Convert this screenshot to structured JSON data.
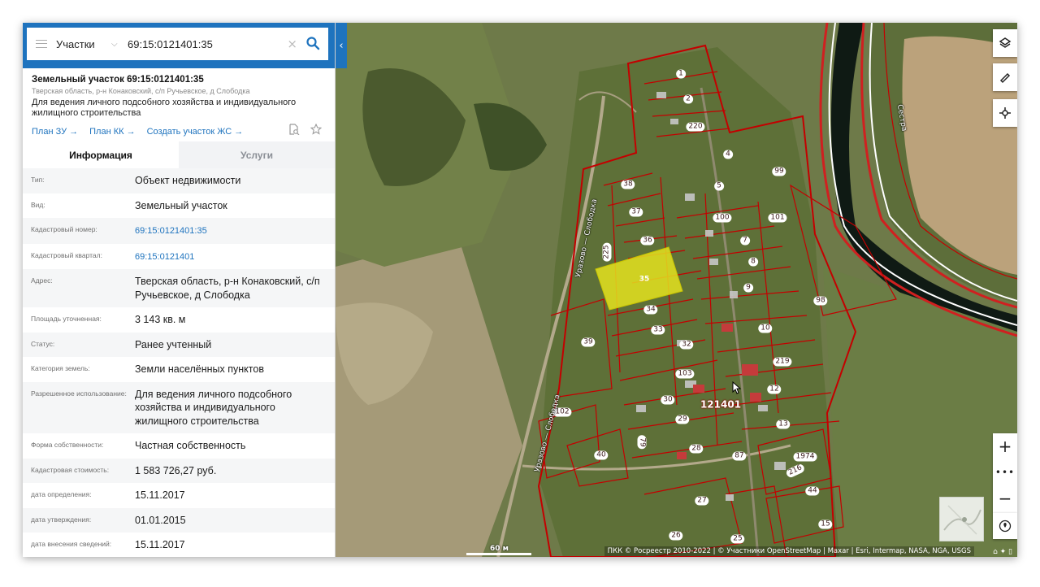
{
  "search": {
    "type_label": "Участки",
    "query": "69:15:0121401:35"
  },
  "object": {
    "title": "Земельный участок 69:15:0121401:35",
    "address": "Тверская область, р-н Конаковский, с/п Ручьевское, д Слободка",
    "purpose": "Для ведения личного подсобного хозяйства и индивидуального жилищного строительства",
    "links": [
      "План ЗУ →",
      "План КК →",
      "Создать участок ЖС →"
    ]
  },
  "tabs": [
    {
      "label": "Информация",
      "active": true
    },
    {
      "label": "Услуги",
      "active": false
    }
  ],
  "info": [
    {
      "key": "Тип:",
      "value": "Объект недвижимости"
    },
    {
      "key": "Вид:",
      "value": "Земельный участок"
    },
    {
      "key": "Кадастровый номер:",
      "value": "69:15:0121401:35",
      "link": true
    },
    {
      "key": "Кадастровый квартал:",
      "value": "69:15:0121401",
      "link": true
    },
    {
      "key": "Адрес:",
      "value": "Тверская область, р-н Конаковский, с/п Ручьевское, д Слободка"
    },
    {
      "key": "Площадь уточненная:",
      "value": "3 143 кв. м"
    },
    {
      "key": "Статус:",
      "value": "Ранее учтенный"
    },
    {
      "key": "Категория земель:",
      "value": "Земли населённых пунктов"
    },
    {
      "key": "Разрешенное использование:",
      "value": "Для ведения личного подсобного хозяйства и индивидуального жилищного строительства"
    },
    {
      "key": "Форма собственности:",
      "value": "Частная собственность"
    },
    {
      "key": "Кадастровая стоимость:",
      "value": "1 583 726,27 руб."
    },
    {
      "key": "дата определения:",
      "value": "15.11.2017"
    },
    {
      "key": "дата утверждения:",
      "value": "01.01.2015"
    },
    {
      "key": "дата внесения сведений:",
      "value": "15.11.2017"
    }
  ],
  "map": {
    "quarter_label": "121401",
    "selected_label": "35",
    "plot_labels": [
      "1",
      "2",
      "220",
      "4",
      "99",
      "38",
      "5",
      "37",
      "100",
      "101",
      "36",
      "7",
      "225",
      "8",
      "9",
      "34",
      "98",
      "33",
      "10",
      "39",
      "32",
      "219",
      "103",
      "12",
      "30",
      "102",
      "29",
      "13",
      "40",
      "79",
      "28",
      "87",
      "1974",
      "216",
      "44",
      "27",
      "15",
      "26",
      "25"
    ],
    "road_labels": [
      "Уразово — Слободка",
      "Уразово — Слободка",
      "Сестра"
    ],
    "scale_label": "60 м",
    "attribution": "ПКК © Росреестр 2010-2022 | © Участники OpenStreetMap | Maxar | Esri, Intermap, NASA, NGA, USGS",
    "zoom_dots": "•••",
    "colors": {
      "boundary": "#c40000",
      "selected": "#e4e21e"
    }
  }
}
